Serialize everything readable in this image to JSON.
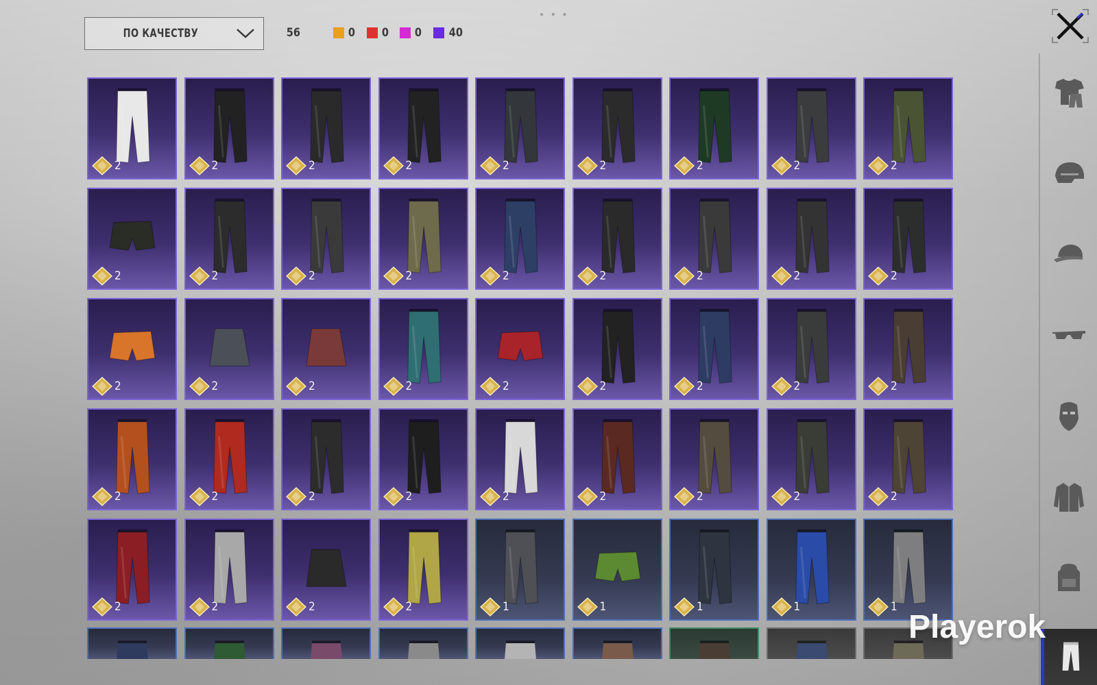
{
  "toolbar": {
    "sort_label": "ПО КАЧЕСТВУ",
    "total_count": "56",
    "rarity_counts": [
      {
        "color": "#e8a020",
        "value": "0"
      },
      {
        "color": "#e03131",
        "value": "0"
      },
      {
        "color": "#d42bd4",
        "value": "0"
      },
      {
        "color": "#6a2be0",
        "value": "40"
      }
    ]
  },
  "grid": {
    "rows": [
      [
        "2",
        "2",
        "2",
        "2",
        "2",
        "2",
        "2",
        "2",
        "2"
      ],
      [
        "2",
        "2",
        "2",
        "2",
        "2",
        "2",
        "2",
        "2",
        "2"
      ],
      [
        "2",
        "2",
        "2",
        "2",
        "2",
        "2",
        "2",
        "2",
        "2"
      ],
      [
        "2",
        "2",
        "2",
        "2",
        "2",
        "2",
        "2",
        "2",
        "2"
      ],
      [
        "2",
        "2",
        "2",
        "2",
        "1",
        "1",
        "1",
        "1",
        "1"
      ]
    ]
  },
  "sidebar": {
    "items": [
      "shirt-icon",
      "helmet-icon",
      "cap-icon",
      "glasses-icon",
      "mask-icon",
      "jacket-icon",
      "backpack-icon",
      "pants-icon"
    ],
    "active": "pants-icon"
  },
  "watermark": "Playerok"
}
